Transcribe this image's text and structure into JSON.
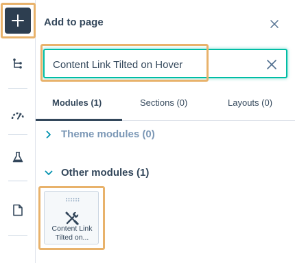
{
  "rail": {
    "add_icon": "plus-icon",
    "items": [
      {
        "icon": "structure-tree-icon"
      },
      {
        "icon": "speedometer-icon"
      },
      {
        "icon": "flask-icon"
      },
      {
        "icon": "page-icon"
      }
    ]
  },
  "panel": {
    "title": "Add to page",
    "close_icon": "close-icon"
  },
  "search": {
    "value": "Content Link Tilted on Hover",
    "clear_icon": "clear-x-icon"
  },
  "tabs": [
    {
      "label": "Modules (1)",
      "active": true
    },
    {
      "label": "Sections (0)",
      "active": false
    },
    {
      "label": "Layouts (0)",
      "active": false
    }
  ],
  "groups": [
    {
      "label": "Theme modules (0)",
      "expanded": false
    },
    {
      "label": "Other modules (1)",
      "expanded": true
    }
  ],
  "module_card": {
    "icon": "wrench-screwdriver-icon",
    "label": "Content Link Tilted on..."
  },
  "colors": {
    "accent": "#00bda5",
    "highlight": "#e8b26b",
    "dark": "#2d3e50",
    "text": "#33475b",
    "muted": "#7c98b6"
  }
}
